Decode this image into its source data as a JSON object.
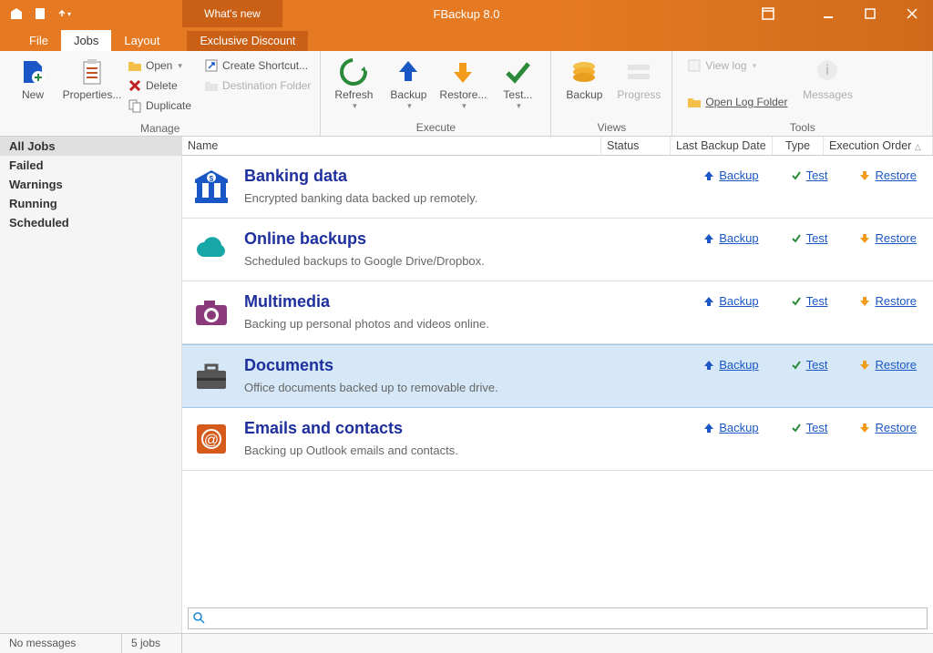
{
  "title": "FBackup 8.0",
  "whats_new": "What's new",
  "tabs": {
    "file": "File",
    "jobs": "Jobs",
    "layout": "Layout",
    "exclusive": "Exclusive Discount"
  },
  "ribbon": {
    "new": "New",
    "properties": "Properties...",
    "open": "Open",
    "delete": "Delete",
    "duplicate": "Duplicate",
    "create_shortcut": "Create Shortcut...",
    "destination_folder": "Destination Folder",
    "refresh": "Refresh",
    "backup": "Backup",
    "restore": "Restore...",
    "test": "Test...",
    "backup2": "Backup",
    "progress": "Progress",
    "view_log": "View log",
    "open_log_folder": "Open Log Folder",
    "messages": "Messages",
    "groups": {
      "manage": "Manage",
      "execute": "Execute",
      "views": "Views",
      "tools": "Tools"
    }
  },
  "sidebar": [
    "All Jobs",
    "Failed",
    "Warnings",
    "Running",
    "Scheduled"
  ],
  "columns": {
    "name": "Name",
    "status": "Status",
    "last": "Last Backup Date",
    "type": "Type",
    "exec": "Execution Order"
  },
  "actions": {
    "backup": "Backup",
    "test": "Test",
    "restore": "Restore"
  },
  "jobs": [
    {
      "title": "Banking data",
      "desc": "Encrypted banking data backed up remotely.",
      "icon": "bank"
    },
    {
      "title": "Online backups",
      "desc": "Scheduled backups to Google Drive/Dropbox.",
      "icon": "cloud"
    },
    {
      "title": "Multimedia",
      "desc": "Backing up personal photos and videos online.",
      "icon": "camera"
    },
    {
      "title": "Documents",
      "desc": "Office documents backed up to removable drive.",
      "icon": "briefcase"
    },
    {
      "title": "Emails and contacts",
      "desc": "Backing up Outlook emails and contacts.",
      "icon": "emails"
    }
  ],
  "selected_job_index": 3,
  "status": {
    "messages": "No messages",
    "jobs": "5 jobs"
  },
  "search_placeholder": ""
}
